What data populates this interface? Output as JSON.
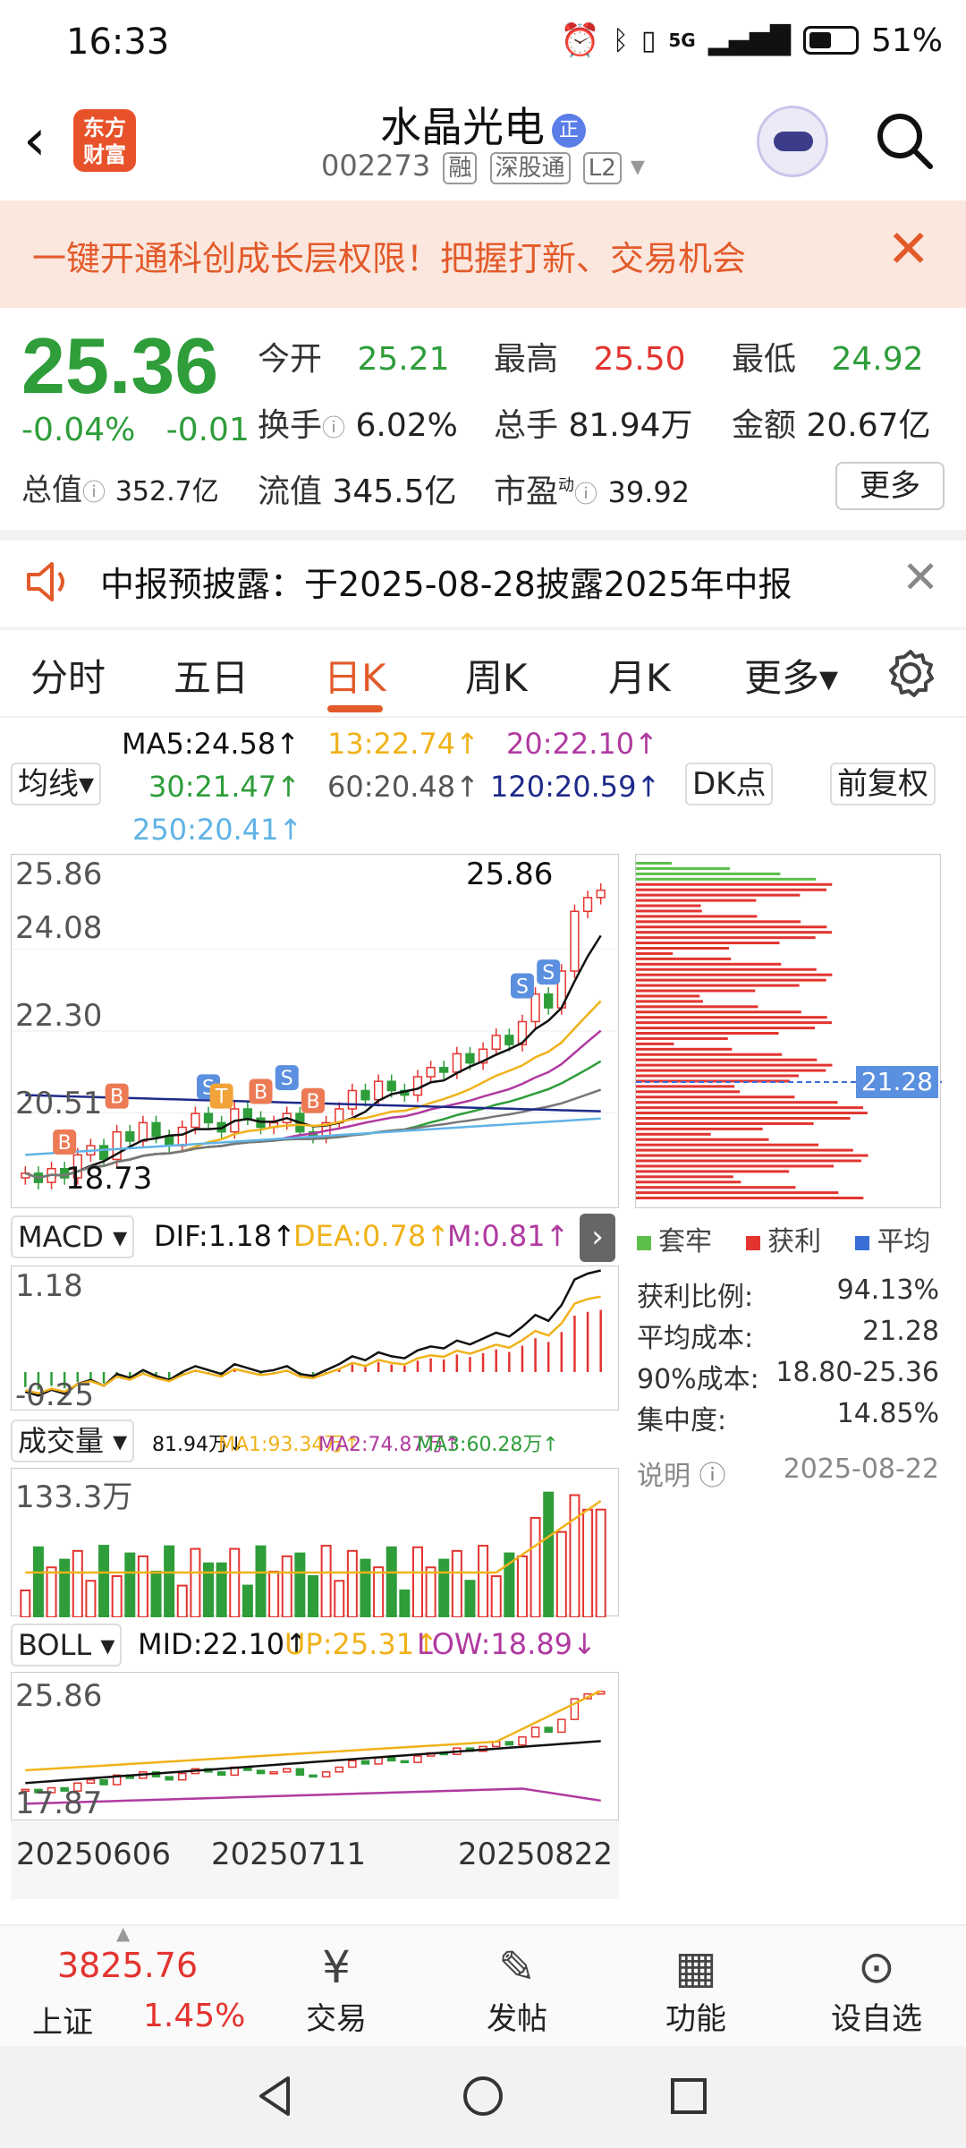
{
  "status": {
    "time": "16:33",
    "battery": "51%",
    "network": "5G"
  },
  "header": {
    "name": "水晶光电",
    "badge": "正",
    "code": "002273",
    "tags": [
      "融",
      "深股通",
      "L2"
    ],
    "logo": "东方财富"
  },
  "banner": {
    "text": "一键开通科创成长层权限！把握打新、交易机会",
    "close": "✕"
  },
  "quote": {
    "price": "25.36",
    "pct": "-0.04%",
    "chg": "-0.01",
    "open_label": "今开",
    "open": "25.21",
    "high_label": "最高",
    "high": "25.50",
    "low_label": "最低",
    "low": "24.92",
    "turnover_label": "换手",
    "turnover": "6.02%",
    "volume_label": "总手",
    "volume": "81.94万",
    "amount_label": "金额",
    "amount": "20.67亿",
    "mcap_label": "总值",
    "mcap": "352.7亿",
    "float_label": "流值",
    "float": "345.5亿",
    "pe_label": "市盈",
    "pe_sup": "动",
    "pe": "39.92",
    "more": "更多"
  },
  "notice": {
    "text": "中报预披露：于2025-08-28披露2025年中报",
    "close": "✕"
  },
  "tabs": [
    "分时",
    "五日",
    "日K",
    "周K",
    "月K",
    "更多▾"
  ],
  "ma": {
    "dropdown": "均线▾",
    "ma5": "MA5:24.58↑",
    "ma13": "13:22.74↑",
    "ma20": "20:22.10↑",
    "ma30": "30:21.47↑",
    "ma60": "60:20.48↑",
    "ma120": "120:20.59↑",
    "ma250": "250:20.41↑",
    "dk": "DK点",
    "fq": "前复权"
  },
  "kline": {
    "ymax": "25.86",
    "y2": "24.08",
    "y3": "22.30",
    "y4": "20.51",
    "ymin": "18.73",
    "peak_label": "25.86",
    "cost_tag": "21.28"
  },
  "macd": {
    "dropdown": "MACD ▾",
    "dif": "DIF:1.18↑",
    "dea": "DEA:0.78↑",
    "m": "M:0.81↑",
    "ymax": "1.18",
    "ymin": "-0.25"
  },
  "vol": {
    "dropdown": "成交量 ▾",
    "v": "81.94万↓",
    "ma1": "MA1:93.34万↑",
    "ma2": "MA2:74.87万↑",
    "ma3": "MA3:60.28万↑",
    "ymax": "133.3万"
  },
  "boll": {
    "dropdown": "BOLL ▾",
    "mid": "MID:22.10↑",
    "up": "UP:25.31↑",
    "low": "LOW:18.89↓",
    "ymax": "25.86",
    "ymin": "17.87"
  },
  "dates": [
    "20250606",
    "20250711",
    "20250822"
  ],
  "chip": {
    "legend": [
      "套牢",
      "获利",
      "平均"
    ],
    "rows": [
      {
        "label": "获利比例:",
        "value": "94.13%"
      },
      {
        "label": "平均成本:",
        "value": "21.28"
      },
      {
        "label": "90%成本:",
        "value": "18.80-25.36"
      },
      {
        "label": "集中度:",
        "value": "14.85%"
      }
    ],
    "note": "说明",
    "date": "2025-08-22"
  },
  "bottom": {
    "index_value": "3825.76",
    "index_name": "上证",
    "index_pct": "1.45%",
    "items": [
      "交易",
      "发帖",
      "功能",
      "设自选"
    ]
  },
  "colors": {
    "up": "#e3342f",
    "down": "#2e9d3a",
    "accent": "#e35a2a",
    "ma5": "#111111",
    "ma13": "#f0b21a",
    "ma20": "#b03aa0",
    "ma30": "#2e9d3a",
    "ma60": "#777777",
    "ma120": "#1e2a8a",
    "ma250": "#5fb3e6"
  },
  "chart_data": {
    "type": "candlestick",
    "title": "",
    "ylim": [
      18.73,
      25.86
    ],
    "series": [
      {
        "values": [
          19.2,
          19.0,
          19.3,
          19.1,
          19.6,
          19.8,
          19.5,
          20.1,
          19.9,
          20.3,
          20.0,
          19.8,
          20.2,
          20.5,
          20.3,
          20.1,
          20.6,
          20.4,
          20.2,
          20.3,
          20.5,
          20.1,
          20.0,
          20.3,
          20.6,
          21.0,
          20.8,
          21.2,
          21.0,
          20.9,
          21.3,
          21.5,
          21.4,
          21.8,
          21.6,
          21.9,
          22.2,
          22.0,
          22.5,
          23.1,
          22.8,
          23.6,
          24.9,
          25.2,
          25.36
        ]
      }
    ]
  }
}
